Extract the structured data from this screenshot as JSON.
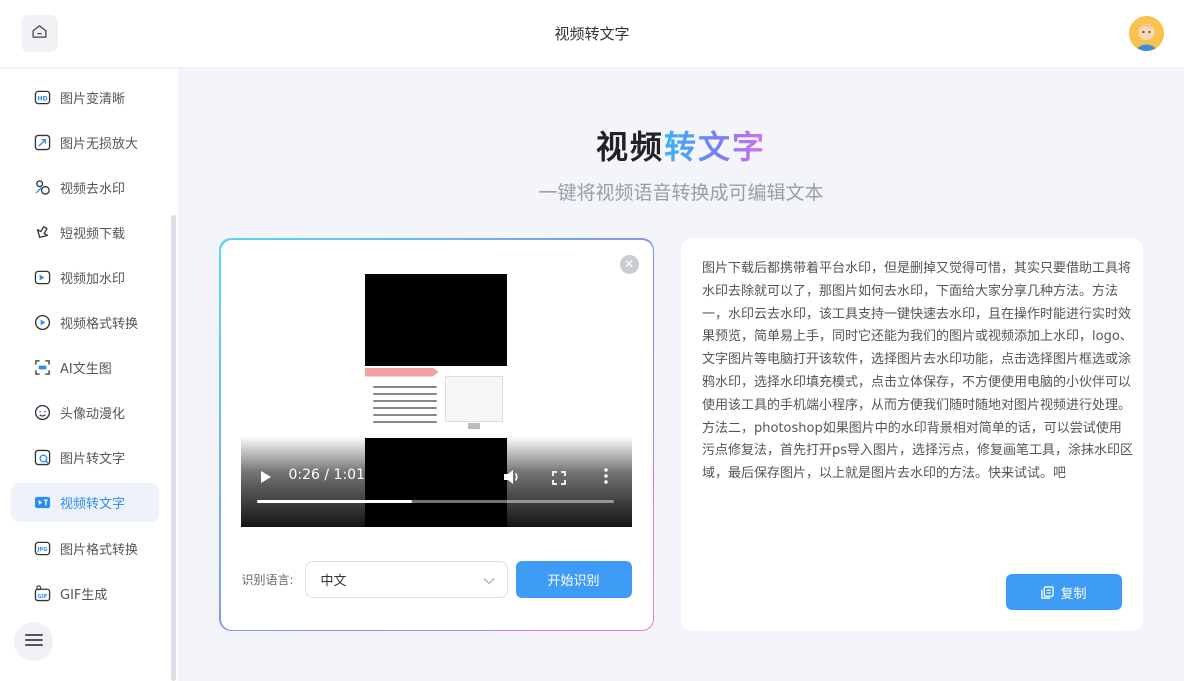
{
  "header": {
    "title": "视频转文字"
  },
  "sidebar": {
    "items": [
      {
        "label": "图片变清晰",
        "icon": "hd-icon"
      },
      {
        "label": "图片无损放大",
        "icon": "enlarge-icon"
      },
      {
        "label": "视频去水印",
        "icon": "video-watermark-remove-icon"
      },
      {
        "label": "短视频下载",
        "icon": "link-download-icon"
      },
      {
        "label": "视频加水印",
        "icon": "video-add-watermark-icon"
      },
      {
        "label": "视频格式转换",
        "icon": "video-convert-icon"
      },
      {
        "label": "AI文生图",
        "icon": "ocr-ai-icon"
      },
      {
        "label": "头像动漫化",
        "icon": "avatar-cartoon-icon"
      },
      {
        "label": "图片转文字",
        "icon": "image-to-text-icon"
      },
      {
        "label": "视频转文字",
        "icon": "video-to-text-icon",
        "active": true
      },
      {
        "label": "图片格式转换",
        "icon": "image-format-icon"
      },
      {
        "label": "GIF生成",
        "icon": "gif-icon"
      }
    ]
  },
  "main": {
    "title_part1": "视频",
    "title_part2": "转文字",
    "subtitle": "一键将视频语音转换成可编辑文本"
  },
  "video": {
    "time": "0:26 / 1:01",
    "progress": 0.436
  },
  "language": {
    "label": "识别语言:",
    "selected": "中文"
  },
  "buttons": {
    "start": "开始识别",
    "copy": "复制"
  },
  "result": {
    "text": "图片下载后都携带着平台水印，但是删掉又觉得可惜，其实只要借助工具将水印去除就可以了，那图片如何去水印，下面给大家分享几种方法。方法一，水印云去水印，该工具支持一键快速去水印，且在操作时能进行实时效果预览，简单易上手，同时它还能为我们的图片或视频添加上水印，logo、文字图片等电脑打开该软件，选择图片去水印功能，点击选择图片框选或涂鸦水印，选择水印填充模式，点击立体保存，不方便使用电脑的小伙伴可以使用该工具的手机端小程序，从而方便我们随时随地对图片视频进行处理。方法二，photoshop如果图片中的水印背景相对简单的话，可以尝试使用污点修复法，首先打开ps导入图片，选择污点，修复画笔工具，涂抹水印区域，最后保存图片，以上就是图片去水印的方法。快来试试。吧"
  },
  "colors": {
    "accent": "#3f9cf6",
    "active_bg": "#eef3fb"
  }
}
